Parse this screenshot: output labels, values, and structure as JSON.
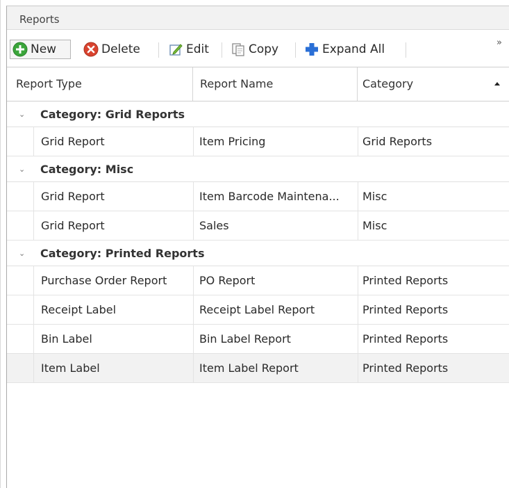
{
  "panel": {
    "title": "Reports"
  },
  "toolbar": {
    "new_label": "New",
    "delete_label": "Delete",
    "edit_label": "Edit",
    "copy_label": "Copy",
    "expand_all_label": "Expand All",
    "more_label": "»"
  },
  "columns": {
    "report_type": "Report Type",
    "report_name": "Report Name",
    "category": "Category"
  },
  "groups": [
    {
      "title": "Category: Grid Reports",
      "rows": [
        {
          "type": "Grid Report",
          "name": "Item Pricing",
          "category": "Grid Reports"
        }
      ]
    },
    {
      "title": "Category: Misc",
      "rows": [
        {
          "type": "Grid Report",
          "name": "Item Barcode Maintena...",
          "category": "Misc"
        },
        {
          "type": "Grid Report",
          "name": "Sales",
          "category": "Misc"
        }
      ]
    },
    {
      "title": "Category: Printed Reports",
      "rows": [
        {
          "type": "Purchase Order Report",
          "name": "PO Report",
          "category": "Printed Reports"
        },
        {
          "type": "Receipt Label",
          "name": "Receipt Label Report",
          "category": "Printed Reports"
        },
        {
          "type": "Bin Label",
          "name": "Bin Label Report",
          "category": "Printed Reports"
        },
        {
          "type": "Item Label",
          "name": "Item Label Report",
          "category": "Printed Reports"
        }
      ]
    }
  ],
  "icons": {
    "new": "plus-circle-icon",
    "delete": "delete-circle-icon",
    "edit": "edit-icon",
    "copy": "copy-icon",
    "expand": "expand-plus-icon",
    "group_toggle": "chevron-down-icon",
    "sort": "sort-ascending-icon"
  },
  "colors": {
    "new_green": "#3aa53a",
    "delete_red": "#d9432f",
    "expand_blue": "#2a6fd6"
  }
}
